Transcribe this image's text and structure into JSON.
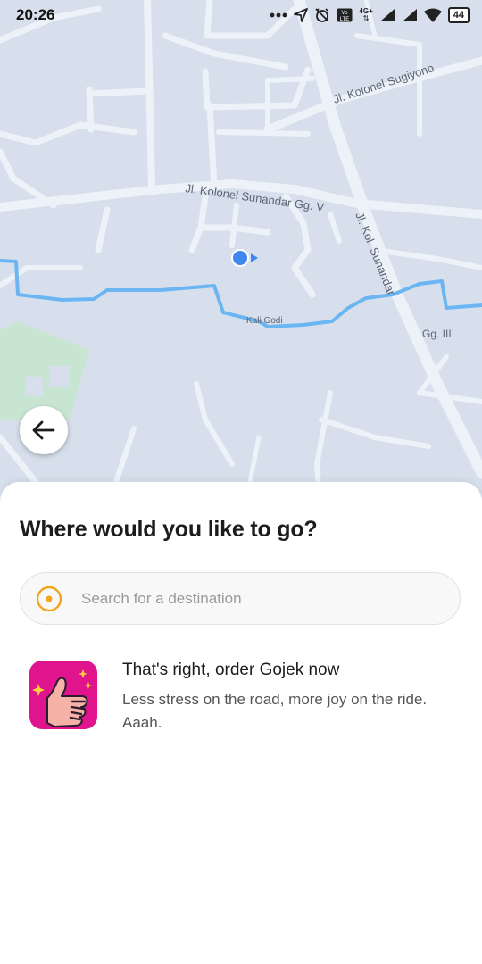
{
  "status_bar": {
    "time": "20:26",
    "network_label": "4G+",
    "volte_label": "Vo LTE",
    "battery": "44"
  },
  "map": {
    "street_labels": [
      "Jl. Kolonel Sugiyono",
      "Jl. Kolonel Sunandar Gg. V",
      "Jl. Kol. Sunandar",
      "Kali Godi",
      "Gg. III"
    ],
    "colors": {
      "background": "#d6dfeb",
      "road": "#edf2f9",
      "river": "#6bb6f2",
      "park": "#c8e5d2",
      "location": "#3f86f0"
    }
  },
  "back_button": {
    "icon": "arrow-left-icon"
  },
  "sheet": {
    "title": "Where would you like to go?",
    "search": {
      "placeholder": "Search for a destination",
      "value": "",
      "icon": "destination-pin-icon",
      "icon_color": "#f1a51c"
    },
    "promo": {
      "title": "That's right, order Gojek now",
      "description": "Less stress on the road, more joy on the ride. Aaah.",
      "image_icon": "thumbs-up-icon",
      "image_color": "#e0148c"
    }
  }
}
